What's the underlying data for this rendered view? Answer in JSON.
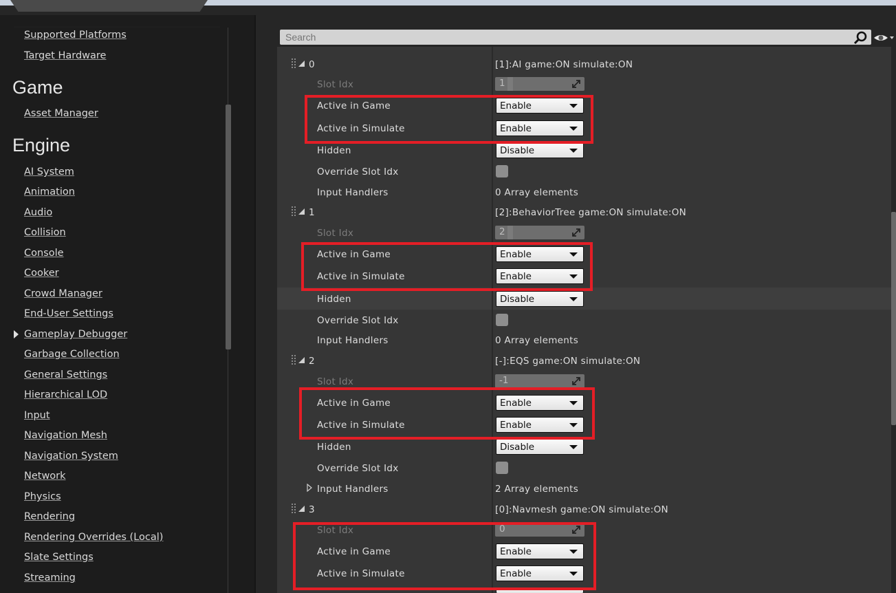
{
  "sidebar": {
    "top_links": [
      "Supported Platforms",
      "Target Hardware"
    ],
    "game_heading": "Game",
    "game_links": [
      "Asset Manager"
    ],
    "engine_heading": "Engine",
    "engine_links": [
      "AI System",
      "Animation",
      "Audio",
      "Collision",
      "Console",
      "Cooker",
      "Crowd Manager",
      "End-User Settings",
      "Gameplay Debugger",
      "Garbage Collection",
      "General Settings",
      "Hierarchical LOD",
      "Input",
      "Navigation Mesh",
      "Navigation System",
      "Network",
      "Physics",
      "Rendering",
      "Rendering Overrides (Local)",
      "Slate Settings",
      "Streaming"
    ]
  },
  "search": {
    "placeholder": "Search"
  },
  "labels": {
    "slot_idx": "Slot Idx",
    "active_in_game": "Active in Game",
    "active_in_simulate": "Active in Simulate",
    "hidden": "Hidden",
    "override_slot_idx": "Override Slot Idx",
    "input_handlers": "Input Handlers"
  },
  "options": {
    "enable": "Enable",
    "disable": "Disable"
  },
  "elements": [
    {
      "index": "0",
      "summary": "[1]:AI game:ON simulate:ON",
      "slot_idx": "1",
      "active_in_game": "Enable",
      "active_in_simulate": "Enable",
      "hidden": "Disable",
      "input_handlers": "0 Array elements"
    },
    {
      "index": "1",
      "summary": "[2]:BehaviorTree game:ON simulate:ON",
      "slot_idx": "2",
      "active_in_game": "Enable",
      "active_in_simulate": "Enable",
      "hidden": "Disable",
      "input_handlers": "0 Array elements"
    },
    {
      "index": "2",
      "summary": "[-]:EQS game:ON simulate:ON",
      "slot_idx": "-1",
      "active_in_game": "Enable",
      "active_in_simulate": "Enable",
      "hidden": "Disable",
      "input_handlers": "2 Array elements"
    },
    {
      "index": "3",
      "summary": "[0]:Navmesh game:ON simulate:ON",
      "slot_idx": "0",
      "active_in_game": "Enable",
      "active_in_simulate": "Enable"
    }
  ],
  "colors": {
    "highlight_box": "#e41e26",
    "panel_bg": "#363636",
    "sidebar_bg": "#1c1c1c"
  }
}
